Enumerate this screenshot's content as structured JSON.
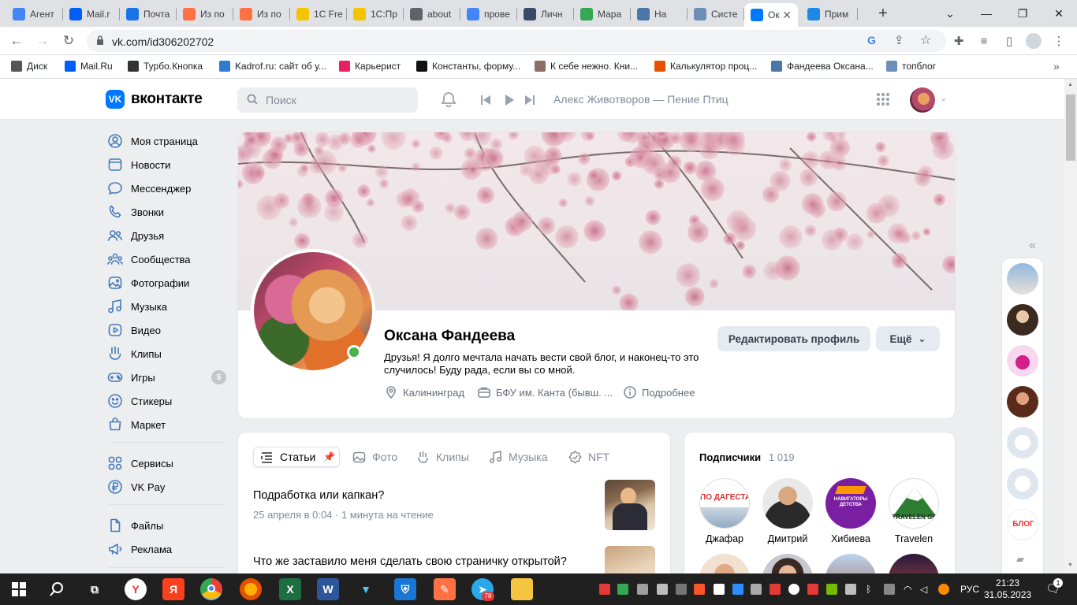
{
  "browser": {
    "tabs": [
      {
        "label": "Агент",
        "icon": "google-icon",
        "color": "#4285f4"
      },
      {
        "label": "Mail.r",
        "icon": "mailru-icon",
        "color": "#005ff9"
      },
      {
        "label": "Почта",
        "icon": "mail-icon",
        "color": "#1a73e8"
      },
      {
        "label": "Из по",
        "icon": "dzen-icon",
        "color": "#ff7043"
      },
      {
        "label": "Из по",
        "icon": "dzen-icon",
        "color": "#ff7043"
      },
      {
        "label": "1С Fre",
        "icon": "1c-icon",
        "color": "#f5c400"
      },
      {
        "label": "1С:Пр",
        "icon": "1c-icon",
        "color": "#f5c400"
      },
      {
        "label": "about",
        "icon": "globe-icon",
        "color": "#5f6368"
      },
      {
        "label": "прове",
        "icon": "google-icon",
        "color": "#4285f4"
      },
      {
        "label": "Личн",
        "icon": "shield-icon",
        "color": "#3a4a6b"
      },
      {
        "label": "Мара",
        "icon": "drive-icon",
        "color": "#34a853"
      },
      {
        "label": "На",
        "icon": "vk-blog-icon",
        "color": "#4a76a8"
      },
      {
        "label": "Систе",
        "icon": "rcb-icon",
        "color": "#6b8fb8"
      },
      {
        "label": "Ок",
        "icon": "vk-icon",
        "color": "#0077ff"
      },
      {
        "label": "Прим",
        "icon": "edge-icon",
        "color": "#1e88e5"
      }
    ],
    "active_tab_index": 13,
    "new_tab": "+",
    "url": "vk.com/id306202702",
    "bookmarks": [
      {
        "label": "Диск",
        "color": "#555"
      },
      {
        "label": "Mail.Ru",
        "color": "#005ff9"
      },
      {
        "label": "Турбо.Кнопка",
        "color": "#333"
      },
      {
        "label": "Kadrof.ru: сайт об у...",
        "color": "#2b7cd3"
      },
      {
        "label": "Карьерист",
        "color": "#e91e63"
      },
      {
        "label": "Константы, форму...",
        "color": "#111"
      },
      {
        "label": "К себе нежно. Кни...",
        "color": "#8d6e63"
      },
      {
        "label": "Калькулятор проц...",
        "color": "#e65100"
      },
      {
        "label": "Фандеева Оксана...",
        "color": "#4a76a8"
      },
      {
        "label": "топблог",
        "color": "#6b8fb8"
      }
    ]
  },
  "vk": {
    "logo_text": "вконтакте",
    "logo_mark": "VK",
    "search_placeholder": "Поиск",
    "now_playing": "Алекс Животворов — Пение Птиц",
    "accent": "#0077ff",
    "sidebar": [
      {
        "label": "Моя страница",
        "icon": "user-circle-icon"
      },
      {
        "label": "Новости",
        "icon": "news-icon"
      },
      {
        "label": "Мессенджер",
        "icon": "message-icon"
      },
      {
        "label": "Звонки",
        "icon": "phone-icon"
      },
      {
        "label": "Друзья",
        "icon": "friends-icon"
      },
      {
        "label": "Сообщества",
        "icon": "communities-icon"
      },
      {
        "label": "Фотографии",
        "icon": "photo-icon"
      },
      {
        "label": "Музыка",
        "icon": "music-icon"
      },
      {
        "label": "Видео",
        "icon": "video-icon"
      },
      {
        "label": "Клипы",
        "icon": "clips-icon"
      },
      {
        "label": "Игры",
        "icon": "gamepad-icon",
        "badge": "5"
      },
      {
        "label": "Стикеры",
        "icon": "smile-icon"
      },
      {
        "label": "Маркет",
        "icon": "bag-icon"
      },
      {
        "label": "Сервисы",
        "icon": "services-icon"
      },
      {
        "label": "VK Pay",
        "icon": "vkpay-icon"
      },
      {
        "label": "Файлы",
        "icon": "file-icon"
      },
      {
        "label": "Реклама",
        "icon": "megaphone-icon"
      }
    ],
    "profile": {
      "name": "Оксана Фандеева",
      "status": "Друзья! Я долго мечтала начать вести свой блог, и наконец-то это случилось! Буду рада, если вы со мной.",
      "city": "Калининград",
      "education": "БФУ им. Канта (бывш. ...",
      "details": "Подробнее",
      "edit_button": "Редактировать профиль",
      "more_button": "Ещё"
    },
    "content_tabs": [
      "Статьи",
      "Фото",
      "Клипы",
      "Музыка",
      "NFT"
    ],
    "articles": [
      {
        "title": "Подработка или капкан?",
        "meta": "25 апреля в 0:04 · 1 минута на чтение"
      },
      {
        "title": "Что же заставило меня сделать свою страничку открытой?",
        "meta": ""
      }
    ],
    "followers": {
      "title": "Подписчики",
      "count": "1 019",
      "items": [
        {
          "name": "Джафар",
          "avatar_text": "ПО ДАГЕСТАНУ"
        },
        {
          "name": "Дмитрий",
          "avatar_text": ""
        },
        {
          "name": "Хибиева",
          "avatar_text": "НАВИГАТОРЫ ДЕТСТВА"
        },
        {
          "name": "Travelen",
          "avatar_text": "TRAVELEN GO"
        }
      ]
    },
    "mini_badge": "БЛОГ"
  },
  "taskbar": {
    "time": "21:23",
    "date": "31.05.2023",
    "lang": "РУС",
    "telegram_badge": "78",
    "notif_badge": "1"
  }
}
